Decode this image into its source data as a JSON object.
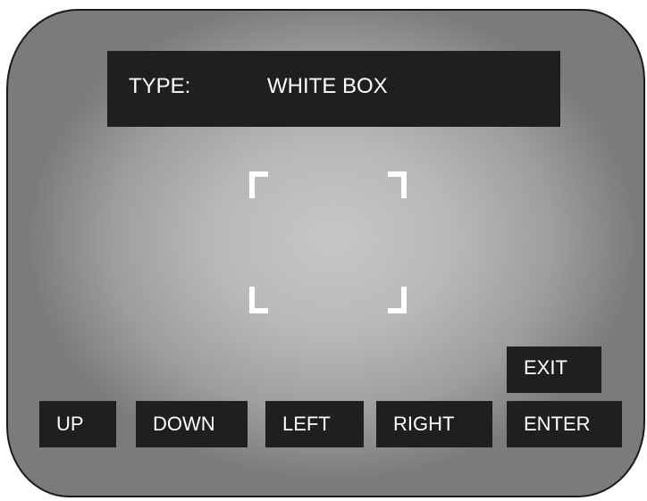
{
  "display": {
    "type_label": "TYPE:",
    "type_value": "WHITE BOX"
  },
  "buttons": {
    "up": "UP",
    "down": "DOWN",
    "left": "LEFT",
    "right": "RIGHT",
    "enter": "ENTER",
    "exit": "EXIT"
  },
  "colors": {
    "panel": "#1f1f1f",
    "text": "#ffffff",
    "frame_marker": "#ffffff"
  }
}
